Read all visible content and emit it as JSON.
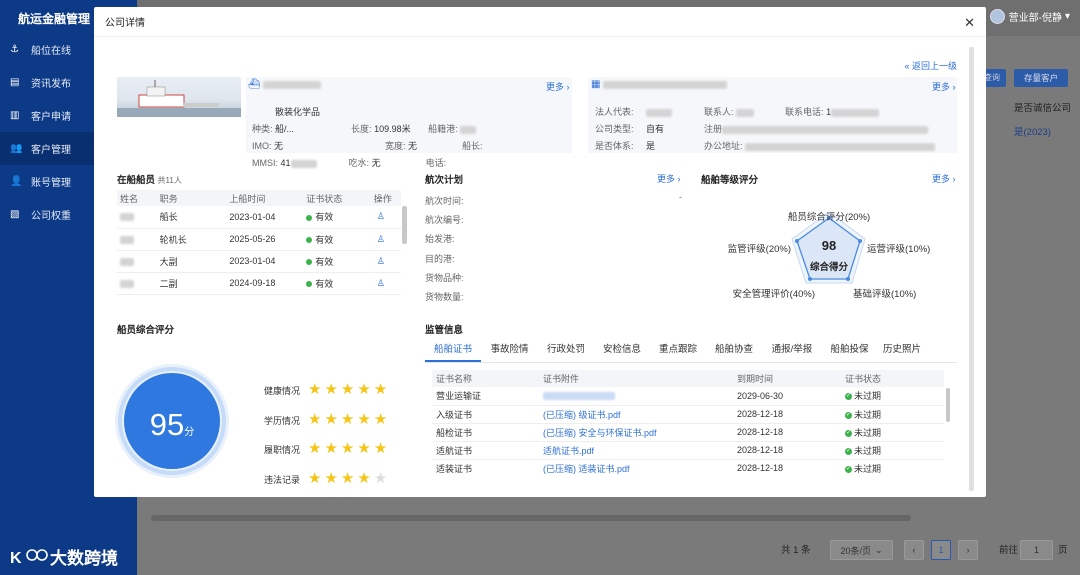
{
  "app": {
    "title": "航运金融管理",
    "user": "营业部-倪静",
    "logo_text": "大数跨境"
  },
  "sidebar": {
    "items": [
      {
        "label": "船位在线",
        "icon": "ship-icon"
      },
      {
        "label": "资讯发布",
        "icon": "document-icon"
      },
      {
        "label": "客户申请",
        "icon": "clipboard-icon"
      },
      {
        "label": "客户管理",
        "icon": "users-icon"
      },
      {
        "label": "账号管理",
        "icon": "user-icon"
      },
      {
        "label": "公司权重",
        "icon": "chart-icon"
      }
    ]
  },
  "background": {
    "btn_query": "查询",
    "btn_stock": "存量客户",
    "col_header": "是否诚信公司",
    "col_value": "是(2023)",
    "pager": {
      "total": "共 1 条",
      "size": "20条/页",
      "page": "1",
      "goto": "前往",
      "goto_page": "1",
      "suffix": "页"
    }
  },
  "modal": {
    "title": "公司详情",
    "back": "返回上一级",
    "ship": {
      "more": "更多",
      "kind_label": "种类:",
      "kind": "散装化学品船/...",
      "length_label": "长度:",
      "length": "109.98米",
      "flag_label": "船籍港:",
      "imo_label": "IMO:",
      "imo": "无",
      "width_label": "宽度:",
      "width": "无",
      "captain_label": "船长:",
      "mmsi_label": "MMSI:",
      "mmsi": "41",
      "draft_label": "吃水:",
      "draft": "无",
      "phone_label": "电话:"
    },
    "company": {
      "more": "更多",
      "rep_label": "法人代表:",
      "contact_label": "联系人:",
      "tel_label": "联系电话:",
      "tel": "1",
      "type_label": "公司类型:",
      "type": "自有",
      "reg_label": "注册",
      "system_label": "是否体系:",
      "system": "是",
      "office_label": "办公地址:"
    },
    "crew": {
      "title": "在船船员",
      "count": "共11人",
      "headers": [
        "姓名",
        "职务",
        "上船时间",
        "证书状态",
        "操作"
      ],
      "rows": [
        {
          "role": "船长",
          "date": "2023-01-04",
          "status": "有效"
        },
        {
          "role": "轮机长",
          "date": "2025-05-26",
          "status": "有效"
        },
        {
          "role": "大副",
          "date": "2023-01-04",
          "status": "有效"
        },
        {
          "role": "二副",
          "date": "2024-09-18",
          "status": "有效"
        }
      ]
    },
    "voyage": {
      "title": "航次计划",
      "more": "更多",
      "fields": [
        "航次时间:",
        "航次编号:",
        "始发港:",
        "目的港:",
        "货物品种:",
        "货物数量:"
      ],
      "dash": "-"
    },
    "rating": {
      "title": "船舶等级评分",
      "more": "更多",
      "score": "98",
      "score_label": "综合得分",
      "axes": [
        "船员综合评分(20%)",
        "运营评级(10%)",
        "基础评级(10%)",
        "安全管理评价(40%)",
        "监管评级(20%)"
      ]
    },
    "crew_score": {
      "title": "船员综合评分",
      "score": "95",
      "unit": "分",
      "items": [
        {
          "label": "健康情况",
          "stars": 5
        },
        {
          "label": "学历情况",
          "stars": 5
        },
        {
          "label": "履职情况",
          "stars": 5
        },
        {
          "label": "违法记录",
          "stars": 4
        }
      ]
    },
    "supervision": {
      "title": "监管信息",
      "tabs": [
        "船舶证书",
        "事故险情",
        "行政处罚",
        "安检信息",
        "重点跟踪",
        "船舶协查",
        "通报/举报",
        "船舶投保",
        "历史照片"
      ],
      "headers": [
        "证书名称",
        "证书附件",
        "到期时间",
        "证书状态"
      ],
      "rows": [
        {
          "name": "营业运输证",
          "file": "",
          "date": "2029-06-30",
          "status": "未过期"
        },
        {
          "name": "入级证书",
          "file": "(已压缩)        级证书.pdf",
          "date": "2028-12-18",
          "status": "未过期"
        },
        {
          "name": "船检证书",
          "file": "(已压缩)          安全与环保证书.pdf",
          "date": "2028-12-18",
          "status": "未过期"
        },
        {
          "name": "适航证书",
          "file": "适航证书.pdf",
          "date": "2028-12-18",
          "status": "未过期"
        },
        {
          "name": "适装证书",
          "file": "(已压缩) 适装证书.pdf",
          "date": "2028-12-18",
          "status": "未过期"
        }
      ]
    }
  },
  "colors": {
    "sidebar": "#0d3a86",
    "accent": "#2e6fd8",
    "valid": "#3bb34a",
    "star": "#f5c518"
  }
}
